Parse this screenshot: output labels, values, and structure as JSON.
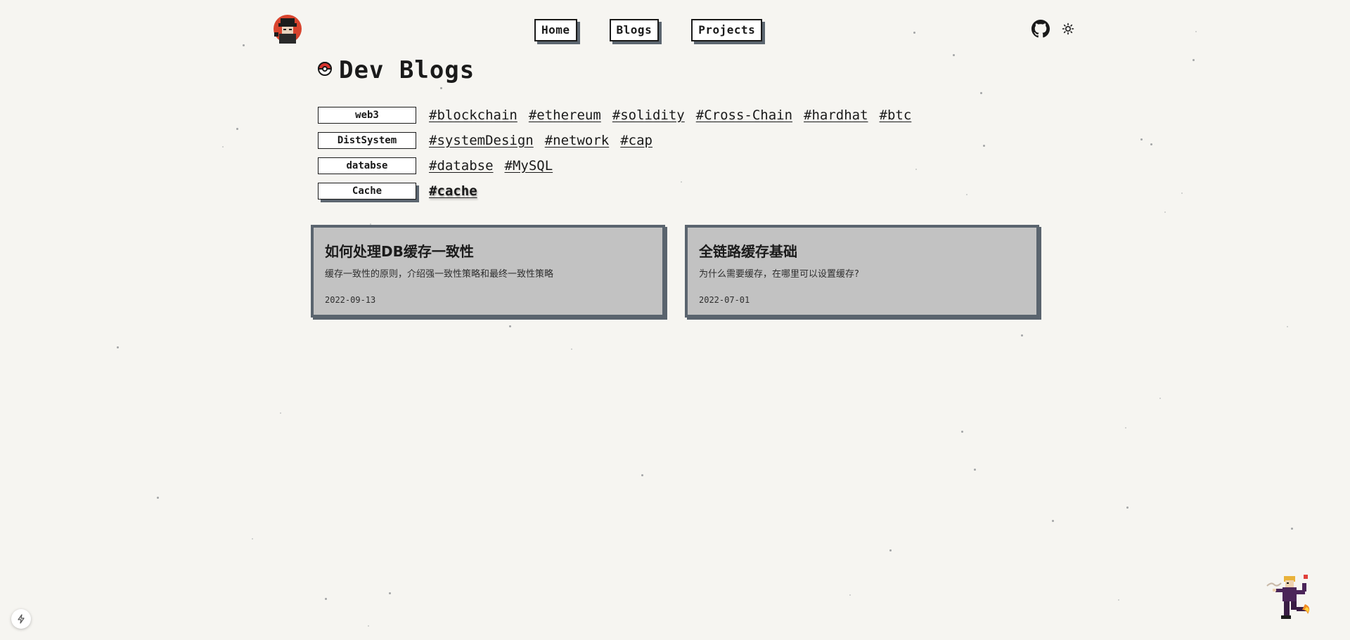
{
  "nav": {
    "home": "Home",
    "blogs": "Blogs",
    "projects": "Projects"
  },
  "page": {
    "title": "Dev Blogs"
  },
  "categories": [
    {
      "label": "web3",
      "tags": [
        "#blockchain",
        "#ethereum",
        "#solidity",
        "#Cross-Chain",
        "#hardhat",
        "#btc"
      ]
    },
    {
      "label": "DistSystem",
      "tags": [
        "#systemDesign",
        "#network",
        "#cap"
      ]
    },
    {
      "label": "databse",
      "tags": [
        "#databse",
        "#MySQL"
      ]
    },
    {
      "label": "Cache",
      "tags": [
        "#cache"
      ]
    }
  ],
  "posts": [
    {
      "title": "如何处理DB缓存一致性",
      "desc": "缓存一致性的原则，介绍强一致性策略和最终一致性策略",
      "date": "2022-09-13"
    },
    {
      "title": "全链路缓存基础",
      "desc": "为什么需要缓存，在哪里可以设置缓存?",
      "date": "2022-07-01"
    }
  ],
  "icons": {
    "github": "github-icon",
    "theme": "sun-icon",
    "title": "pokeball-icon",
    "corner": "bolt-icon"
  },
  "colors": {
    "background": "#f6f5f1",
    "card": "#c2c2c2",
    "card_border": "#5a646e",
    "shadow": "#5c6670"
  }
}
